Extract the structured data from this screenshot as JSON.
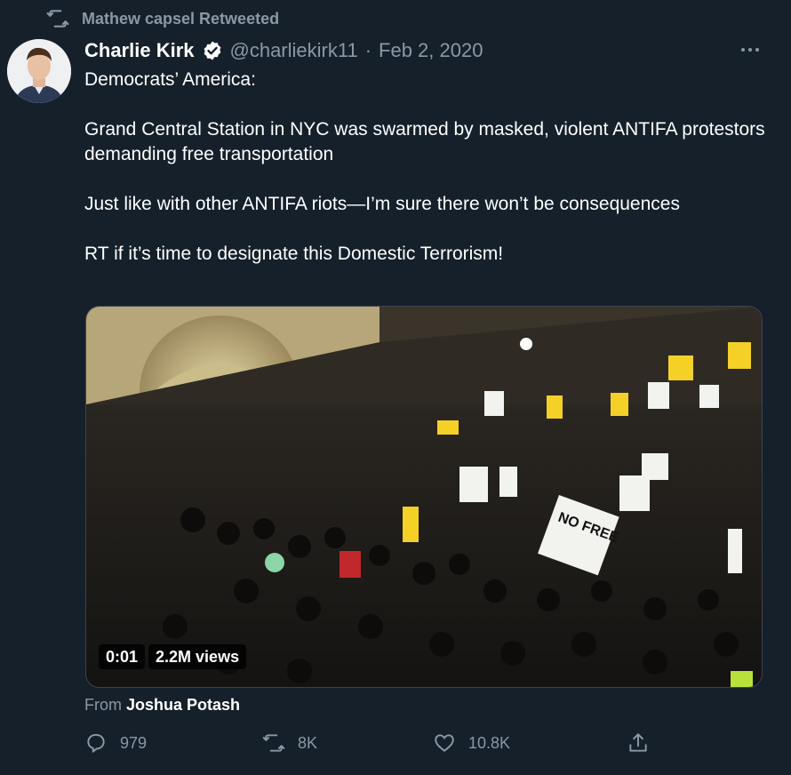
{
  "retweet": {
    "text": "Mathew capsel Retweeted",
    "icon": "retweet-icon"
  },
  "author": {
    "name": "Charlie Kirk",
    "handle": "@charliekirk11",
    "separator": "·",
    "date": "Feb 2, 2020",
    "verified_icon": "verified-badge-icon"
  },
  "tweet": {
    "lines": [
      "Democrats’ America:",
      "Grand Central Station in NYC was swarmed by masked, violent ANTIFA protestors demanding free transportation",
      "Just like with other ANTIFA riots—I’m sure there won’t be consequences",
      "RT if it’s time to designate this Domestic Terrorism!"
    ]
  },
  "video": {
    "time": "0:01",
    "views": "2.2M views",
    "sign_text": "NO FREE"
  },
  "attribution": {
    "prefix": "From",
    "name": "Joshua Potash"
  },
  "actions": {
    "replies": "979",
    "retweets": "8K",
    "likes": "10.8K"
  },
  "colors": {
    "background": "#15202b",
    "muted": "#8b98a5",
    "verified": "#ffffff"
  }
}
